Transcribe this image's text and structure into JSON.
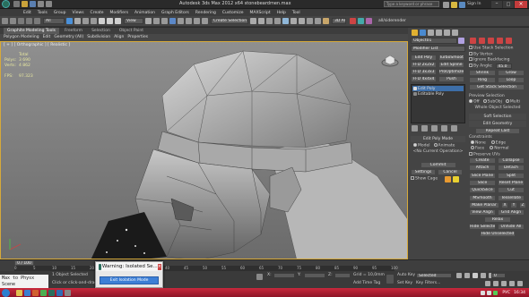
{
  "titlebar": {
    "title": "Autodesk 3ds Max  2012 x64      stonebeardmen.max",
    "search_placeholder": "Type a keyword or phrase",
    "sign_in": "Sign In"
  },
  "menubar": [
    "Edit",
    "Tools",
    "Group",
    "Views",
    "Create",
    "Modifiers",
    "Animation",
    "Graph Editors",
    "Rendering",
    "Customize",
    "MAXScript",
    "Help",
    "Tool"
  ],
  "toolbar": {
    "filter": "All",
    "view": "View",
    "selection_set": "Create Selection Set",
    "workspace": "3D Align",
    "active_set": "all/siderender"
  },
  "ribbon": {
    "tabs": [
      "Graphite Modeling Tools",
      "Freeform",
      "Selection",
      "Object Paint"
    ],
    "subtabs": [
      "Polygon Modeling",
      "Edit",
      "Geometry (All)",
      "Subdivision",
      "Align",
      "Properties"
    ]
  },
  "viewport": {
    "label": "[ + ] [ Orthographic ] [ Realistic ]",
    "stats": {
      "header": "Total",
      "polys_label": "Polys:",
      "polys_value": "3 690",
      "verts_label": "Verts:",
      "verts_value": "4 862",
      "fps_label": "FPS:",
      "fps_value": "97.323"
    }
  },
  "command_panel": {
    "object_name": "Object01",
    "modifier_list": "Modifier List",
    "buttons": [
      [
        "Edit Poly",
        "TurboSmooth"
      ],
      [
        "FFD 2x2x2",
        "Edit Spline"
      ],
      [
        "FFD 3x3x3",
        "ProOptimizer"
      ],
      [
        "FFD 4x4x4",
        "Push"
      ]
    ],
    "stack": [
      "Edit Poly",
      "Editable Poly"
    ],
    "edit_poly_mode": {
      "title": "Edit Poly Mode",
      "model": "Model",
      "animate": "Animate",
      "status": "<No Current Operation>",
      "commit": "Commit",
      "settings": "Settings",
      "cancel": "Cancel",
      "show_cage": "Show Cage"
    },
    "selection": {
      "title": "Selection",
      "use_stack": "Use Stack Selection",
      "by_vertex": "By Vertex",
      "ignore_bf": "Ignore Backfacing",
      "by_angle": "By Angle:",
      "by_angle_value": "45.0",
      "shrink": "Shrink",
      "grow": "Grow",
      "ring": "Ring",
      "loop": "Loop",
      "get_stack": "Get Stack Selection"
    },
    "preview": {
      "title": "Preview Selection",
      "off": "Off",
      "subobj": "SubObj",
      "multi": "Multi",
      "whole": "Whole Object Selected"
    },
    "soft": {
      "title": "Soft Selection"
    },
    "edit_geometry": {
      "title": "Edit Geometry",
      "repeat": "Repeat Last",
      "constraints": "Constraints",
      "none": "None",
      "edge": "Edge",
      "face": "Face",
      "normal": "Normal",
      "preserve_uvs": "Preserve UVs",
      "create": "Create",
      "collapse": "Collapse",
      "attach": "Attach",
      "detach": "Detach",
      "slice_plane": "Slice Plane",
      "split": "Split",
      "slice": "Slice",
      "reset_plane": "Reset Plane",
      "quickslice": "QuickSlice",
      "cut": "Cut",
      "msmooth": "MSmooth",
      "tessellate": "Tessellate",
      "make_planar": "Make Planar",
      "x": "X",
      "y": "Y",
      "z": "Z",
      "view_align": "View Align",
      "grid_align": "Grid Align",
      "relax": "Relax",
      "hide_selected": "Hide Selected",
      "unhide_all": "Unhide All",
      "hide_unselected": "Hide Unselected"
    }
  },
  "timeline": {
    "frame": "0 / 100",
    "ticks": [
      "0",
      "5",
      "10",
      "15",
      "20",
      "25",
      "30",
      "35",
      "40",
      "45",
      "50",
      "55",
      "60",
      "65",
      "70",
      "75",
      "80",
      "85",
      "90",
      "95",
      "100"
    ]
  },
  "statusbar": {
    "object_selected": "1 Object Selected",
    "hint": "Click or click-and-drag to select objects",
    "x": "X:",
    "y": "Y:",
    "z": "Z:",
    "grid": "Grid = 10,0mm",
    "auto_key": "Auto Key",
    "selected": "Selected",
    "set_key": "Set Key",
    "key_filters": "Key Filters...",
    "add_time_tag": "Add Time Tag",
    "frame_value": "0"
  },
  "maxscript": {
    "text": "Max to Physx Scene"
  },
  "warning": {
    "title": "Warning: Isolated Se...",
    "button": "Exit Isolation Mode"
  },
  "taskbar": {
    "lang": "РУС",
    "time": "16:34"
  },
  "colors": {
    "accent": "#3d6ea8",
    "panel": "#444444",
    "viewport_top": "#8a8a8a",
    "viewport_bottom": "#6e6e6e",
    "taskbar": "#b02033"
  }
}
